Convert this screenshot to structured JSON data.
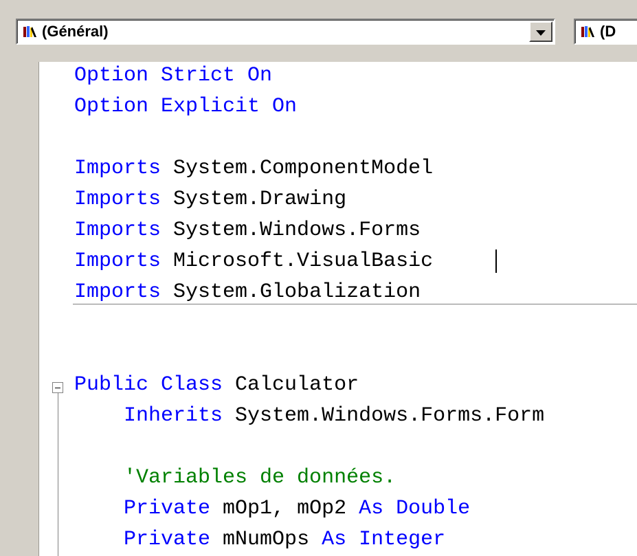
{
  "toolbar": {
    "object_combo_text": "(Général)",
    "event_combo_text": "(D"
  },
  "code": {
    "lines": [
      {
        "parts": [
          {
            "t": "Option Strict On",
            "c": "kw"
          }
        ]
      },
      {
        "parts": [
          {
            "t": "Option Explicit On",
            "c": "kw"
          }
        ]
      },
      {
        "parts": [
          {
            "t": "",
            "c": "id"
          }
        ]
      },
      {
        "parts": [
          {
            "t": "Imports ",
            "c": "kw"
          },
          {
            "t": "System.ComponentModel",
            "c": "id"
          }
        ]
      },
      {
        "parts": [
          {
            "t": "Imports ",
            "c": "kw"
          },
          {
            "t": "System.Drawing",
            "c": "id"
          }
        ]
      },
      {
        "parts": [
          {
            "t": "Imports ",
            "c": "kw"
          },
          {
            "t": "System.Windows.Forms",
            "c": "id"
          }
        ]
      },
      {
        "parts": [
          {
            "t": "Imports ",
            "c": "kw"
          },
          {
            "t": "Microsoft.VisualBasic",
            "c": "id"
          }
        ]
      },
      {
        "parts": [
          {
            "t": "Imports ",
            "c": "kw"
          },
          {
            "t": "System.Globalization",
            "c": "id"
          }
        ]
      },
      {
        "parts": [
          {
            "t": "",
            "c": "id"
          }
        ]
      },
      {
        "parts": [
          {
            "t": "",
            "c": "id"
          }
        ]
      },
      {
        "parts": [
          {
            "t": "Public Class ",
            "c": "kw"
          },
          {
            "t": "Calculator",
            "c": "id"
          }
        ]
      },
      {
        "parts": [
          {
            "t": "    ",
            "c": "id"
          },
          {
            "t": "Inherits ",
            "c": "kw"
          },
          {
            "t": "System.Windows.Forms.Form",
            "c": "id"
          }
        ]
      },
      {
        "parts": [
          {
            "t": "",
            "c": "id"
          }
        ]
      },
      {
        "parts": [
          {
            "t": "    ",
            "c": "id"
          },
          {
            "t": "'Variables de données.",
            "c": "comment"
          }
        ]
      },
      {
        "parts": [
          {
            "t": "    ",
            "c": "id"
          },
          {
            "t": "Private ",
            "c": "kw"
          },
          {
            "t": "mOp1, mOp2 ",
            "c": "id"
          },
          {
            "t": "As Double",
            "c": "kw"
          }
        ]
      },
      {
        "parts": [
          {
            "t": "    ",
            "c": "id"
          },
          {
            "t": "Private ",
            "c": "kw"
          },
          {
            "t": "mNumOps ",
            "c": "id"
          },
          {
            "t": "As Integer",
            "c": "kw"
          }
        ]
      }
    ]
  },
  "colors": {
    "keyword": "#0000ff",
    "identifier": "#000000",
    "comment": "#008000",
    "chrome": "#d4d0c8"
  },
  "icons": {
    "object_combo": "vb-class-icon",
    "event_combo": "vb-class-icon",
    "dropdown": "chevron-down-icon",
    "fold": "collapse-icon"
  }
}
